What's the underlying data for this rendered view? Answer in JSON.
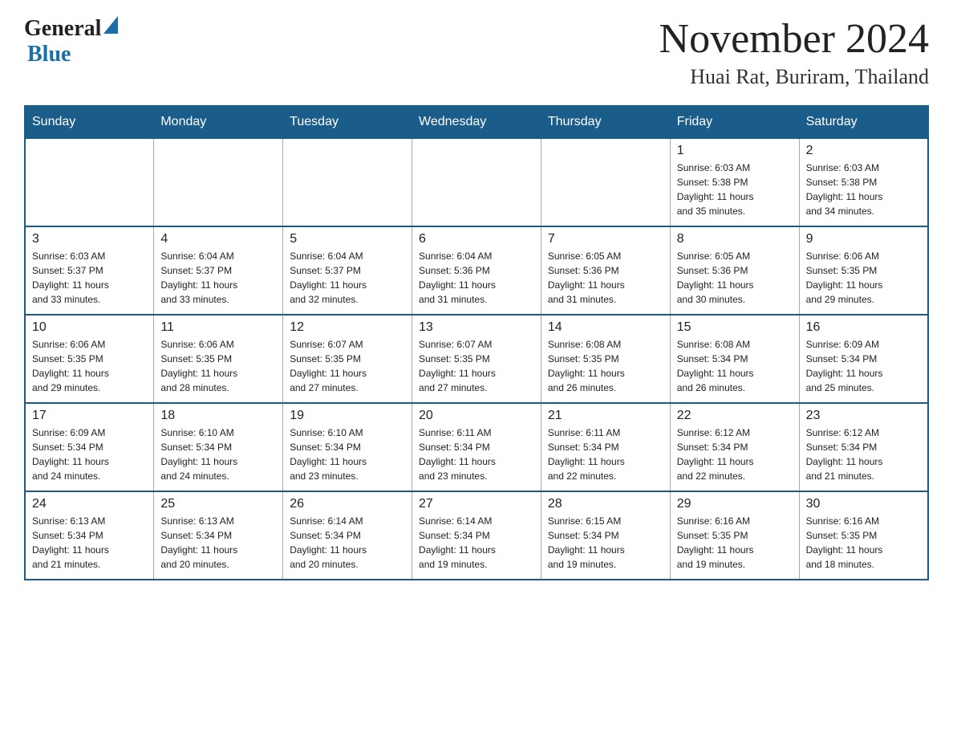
{
  "header": {
    "month_title": "November 2024",
    "location": "Huai Rat, Buriram, Thailand",
    "logo_general": "General",
    "logo_blue": "Blue"
  },
  "days_of_week": [
    "Sunday",
    "Monday",
    "Tuesday",
    "Wednesday",
    "Thursday",
    "Friday",
    "Saturday"
  ],
  "weeks": [
    [
      {
        "day": "",
        "info": ""
      },
      {
        "day": "",
        "info": ""
      },
      {
        "day": "",
        "info": ""
      },
      {
        "day": "",
        "info": ""
      },
      {
        "day": "",
        "info": ""
      },
      {
        "day": "1",
        "info": "Sunrise: 6:03 AM\nSunset: 5:38 PM\nDaylight: 11 hours\nand 35 minutes."
      },
      {
        "day": "2",
        "info": "Sunrise: 6:03 AM\nSunset: 5:38 PM\nDaylight: 11 hours\nand 34 minutes."
      }
    ],
    [
      {
        "day": "3",
        "info": "Sunrise: 6:03 AM\nSunset: 5:37 PM\nDaylight: 11 hours\nand 33 minutes."
      },
      {
        "day": "4",
        "info": "Sunrise: 6:04 AM\nSunset: 5:37 PM\nDaylight: 11 hours\nand 33 minutes."
      },
      {
        "day": "5",
        "info": "Sunrise: 6:04 AM\nSunset: 5:37 PM\nDaylight: 11 hours\nand 32 minutes."
      },
      {
        "day": "6",
        "info": "Sunrise: 6:04 AM\nSunset: 5:36 PM\nDaylight: 11 hours\nand 31 minutes."
      },
      {
        "day": "7",
        "info": "Sunrise: 6:05 AM\nSunset: 5:36 PM\nDaylight: 11 hours\nand 31 minutes."
      },
      {
        "day": "8",
        "info": "Sunrise: 6:05 AM\nSunset: 5:36 PM\nDaylight: 11 hours\nand 30 minutes."
      },
      {
        "day": "9",
        "info": "Sunrise: 6:06 AM\nSunset: 5:35 PM\nDaylight: 11 hours\nand 29 minutes."
      }
    ],
    [
      {
        "day": "10",
        "info": "Sunrise: 6:06 AM\nSunset: 5:35 PM\nDaylight: 11 hours\nand 29 minutes."
      },
      {
        "day": "11",
        "info": "Sunrise: 6:06 AM\nSunset: 5:35 PM\nDaylight: 11 hours\nand 28 minutes."
      },
      {
        "day": "12",
        "info": "Sunrise: 6:07 AM\nSunset: 5:35 PM\nDaylight: 11 hours\nand 27 minutes."
      },
      {
        "day": "13",
        "info": "Sunrise: 6:07 AM\nSunset: 5:35 PM\nDaylight: 11 hours\nand 27 minutes."
      },
      {
        "day": "14",
        "info": "Sunrise: 6:08 AM\nSunset: 5:35 PM\nDaylight: 11 hours\nand 26 minutes."
      },
      {
        "day": "15",
        "info": "Sunrise: 6:08 AM\nSunset: 5:34 PM\nDaylight: 11 hours\nand 26 minutes."
      },
      {
        "day": "16",
        "info": "Sunrise: 6:09 AM\nSunset: 5:34 PM\nDaylight: 11 hours\nand 25 minutes."
      }
    ],
    [
      {
        "day": "17",
        "info": "Sunrise: 6:09 AM\nSunset: 5:34 PM\nDaylight: 11 hours\nand 24 minutes."
      },
      {
        "day": "18",
        "info": "Sunrise: 6:10 AM\nSunset: 5:34 PM\nDaylight: 11 hours\nand 24 minutes."
      },
      {
        "day": "19",
        "info": "Sunrise: 6:10 AM\nSunset: 5:34 PM\nDaylight: 11 hours\nand 23 minutes."
      },
      {
        "day": "20",
        "info": "Sunrise: 6:11 AM\nSunset: 5:34 PM\nDaylight: 11 hours\nand 23 minutes."
      },
      {
        "day": "21",
        "info": "Sunrise: 6:11 AM\nSunset: 5:34 PM\nDaylight: 11 hours\nand 22 minutes."
      },
      {
        "day": "22",
        "info": "Sunrise: 6:12 AM\nSunset: 5:34 PM\nDaylight: 11 hours\nand 22 minutes."
      },
      {
        "day": "23",
        "info": "Sunrise: 6:12 AM\nSunset: 5:34 PM\nDaylight: 11 hours\nand 21 minutes."
      }
    ],
    [
      {
        "day": "24",
        "info": "Sunrise: 6:13 AM\nSunset: 5:34 PM\nDaylight: 11 hours\nand 21 minutes."
      },
      {
        "day": "25",
        "info": "Sunrise: 6:13 AM\nSunset: 5:34 PM\nDaylight: 11 hours\nand 20 minutes."
      },
      {
        "day": "26",
        "info": "Sunrise: 6:14 AM\nSunset: 5:34 PM\nDaylight: 11 hours\nand 20 minutes."
      },
      {
        "day": "27",
        "info": "Sunrise: 6:14 AM\nSunset: 5:34 PM\nDaylight: 11 hours\nand 19 minutes."
      },
      {
        "day": "28",
        "info": "Sunrise: 6:15 AM\nSunset: 5:34 PM\nDaylight: 11 hours\nand 19 minutes."
      },
      {
        "day": "29",
        "info": "Sunrise: 6:16 AM\nSunset: 5:35 PM\nDaylight: 11 hours\nand 19 minutes."
      },
      {
        "day": "30",
        "info": "Sunrise: 6:16 AM\nSunset: 5:35 PM\nDaylight: 11 hours\nand 18 minutes."
      }
    ]
  ]
}
